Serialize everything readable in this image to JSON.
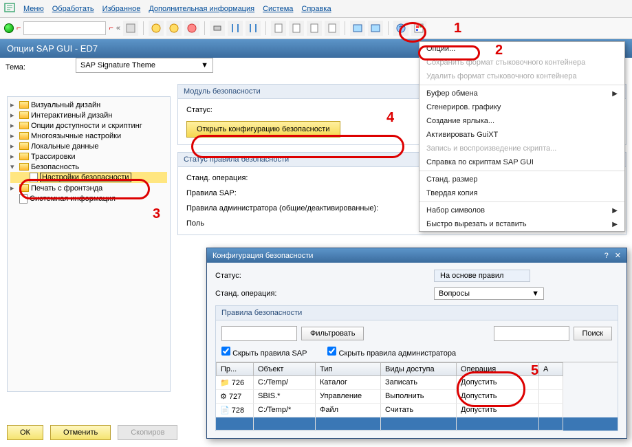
{
  "menu": {
    "items": [
      "Меню",
      "Обработать",
      "Избранное",
      "Дополнительная информация",
      "Система",
      "Справка"
    ]
  },
  "window_title": "Опции SAP GUI - ED7",
  "theme": {
    "label": "Тема:",
    "value": "SAP Signature Theme"
  },
  "search_label": "Поиск",
  "tree": {
    "items": [
      {
        "label": "Визуальный дизайн",
        "exp": "▸"
      },
      {
        "label": "Интерактивный дизайн",
        "exp": "▸"
      },
      {
        "label": "Опции доступности и скриптинг",
        "exp": "▸"
      },
      {
        "label": "Многоязычные настройки",
        "exp": "▸"
      },
      {
        "label": "Локальные данные",
        "exp": "▸"
      },
      {
        "label": "Трассировки",
        "exp": "▸"
      },
      {
        "label": "Безопасность",
        "exp": "▾",
        "open": true
      },
      {
        "label": "Настройки безопасности",
        "doc": true,
        "indent": 2,
        "sel": true
      },
      {
        "label": "Печать с фронтэнда",
        "exp": "▸"
      },
      {
        "label": "Системная информация",
        "doc": true
      }
    ]
  },
  "buttons": {
    "ok": "ОК",
    "cancel": "Отменить",
    "copy": "Скопиров"
  },
  "security_module": {
    "title": "Модуль безопасности",
    "status_label": "Статус:",
    "open_btn": "Открыть конфигурацию безопасности"
  },
  "rule_status": {
    "title": "Статус правила безопасности",
    "std_op": "Станд. операция:",
    "sap_rules": "Правила SAP:",
    "admin_rules": "Правила администратора (общие/деактивированные):",
    "user": "Поль"
  },
  "ctx": {
    "options": "Опции...",
    "save_dock": "Сохранить формат стыковочного контейнера",
    "del_dock": "Удалить формат стыковочного контейнера",
    "clipboard": "Буфер обмена",
    "gen_graphic": "Сгенериров. графику",
    "create_shortcut": "Создание ярлыка...",
    "activate_guixt": "Активировать GuiXT",
    "script_rec": "Запись и воспроизведение скрипта...",
    "script_help": "Справка по скриптам SAP GUI",
    "std_size": "Станд. размер",
    "hardcopy": "Твердая копия",
    "charset": "Набор символов",
    "quick_cut": "Быстро вырезать и вставить"
  },
  "dialog": {
    "title": "Конфигурация безопасности",
    "status_label": "Статус:",
    "status_value": "На основе правил",
    "std_op_label": "Станд. операция:",
    "std_op_value": "Вопросы",
    "rules_title": "Правила безопасности",
    "filter_btn": "Фильтровать",
    "search_btn": "Поиск",
    "hide_sap": "Скрыть правила SAP",
    "hide_admin": "Скрыть правила администратора",
    "cols": {
      "c1": "Пр...",
      "c2": "Объект",
      "c3": "Тип",
      "c4": "Виды доступа",
      "c5": "Операция",
      "c6": "А"
    },
    "rows": [
      {
        "icon": "folder",
        "id": "726",
        "obj": "C:/Temp/",
        "type": "Каталог",
        "acc": "Записать",
        "op": "Допустить"
      },
      {
        "icon": "gear",
        "id": "727",
        "obj": "SBIS.*",
        "type": "Управление",
        "acc": "Выполнить",
        "op": "Допустить"
      },
      {
        "icon": "file",
        "id": "728",
        "obj": "C:/Temp/*",
        "type": "Файл",
        "acc": "Считать",
        "op": "Допустить"
      }
    ]
  },
  "annotations": {
    "n1": "1",
    "n2": "2",
    "n3": "3",
    "n4": "4",
    "n5": "5"
  }
}
